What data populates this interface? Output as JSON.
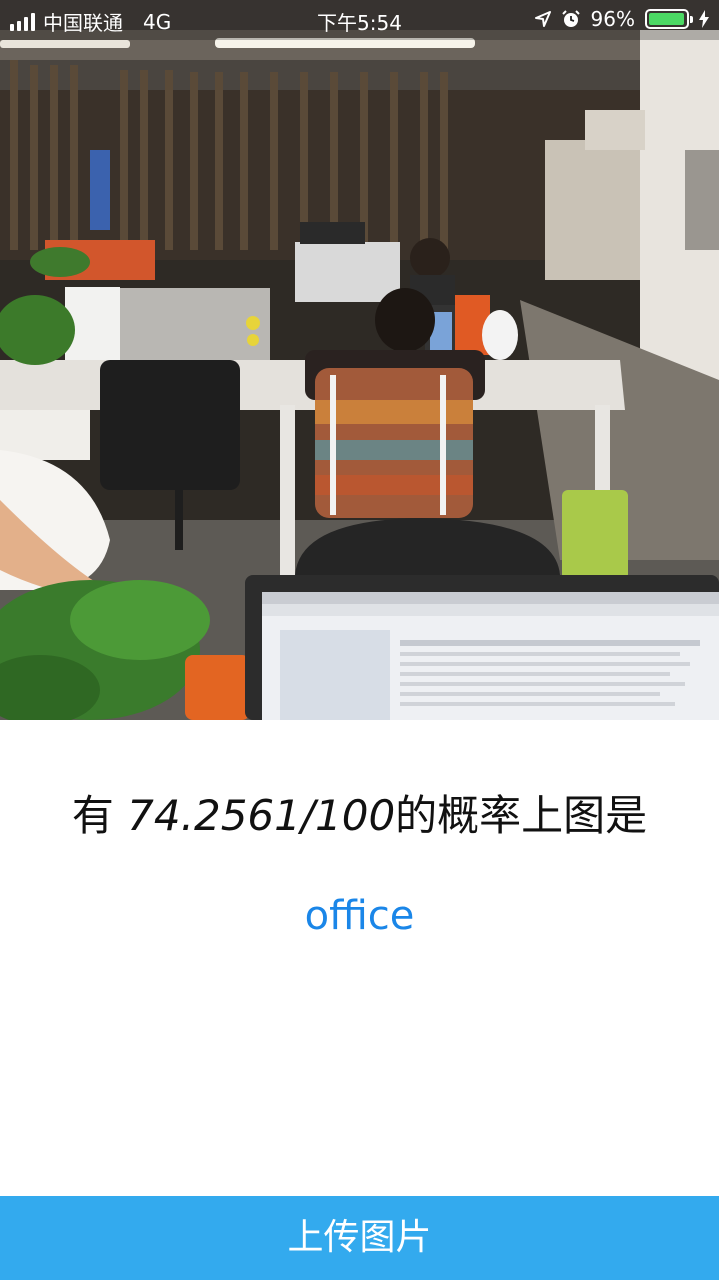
{
  "status_bar": {
    "carrier": "中国联通",
    "network": "4G",
    "time": "下午5:54",
    "battery_percent": "96%",
    "battery_level": 0.96,
    "icons": [
      "signal-icon",
      "location-arrow-icon",
      "alarm-icon",
      "battery-icon",
      "charging-bolt-icon"
    ]
  },
  "photo": {
    "subject": "office"
  },
  "result": {
    "prefix": "有 ",
    "probability": "74.2561/100",
    "suffix": "的概率上图是",
    "label": "office"
  },
  "upload_button": {
    "label": "上传图片"
  },
  "colors": {
    "accent": "#33aaee",
    "label_blue": "#1a86e8",
    "battery_green": "#4cd964"
  }
}
